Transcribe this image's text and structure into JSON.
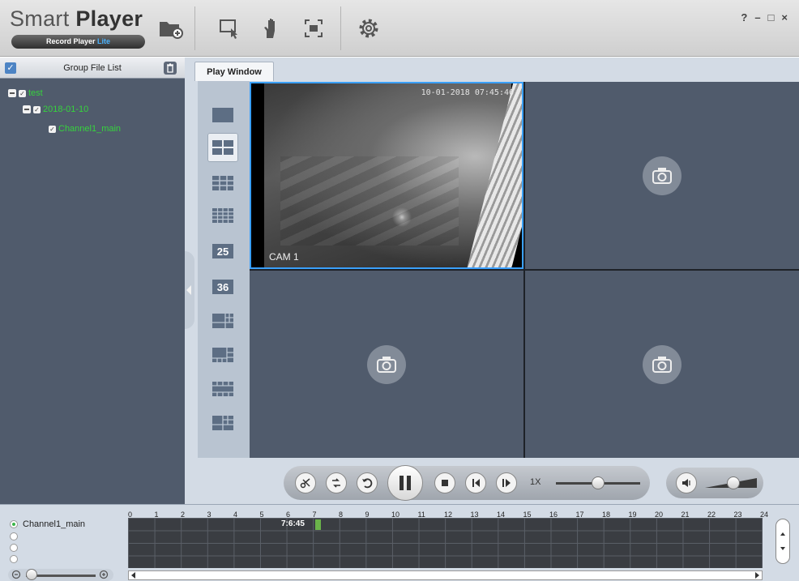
{
  "app": {
    "title_light": "Smart",
    "title_bold": "Player",
    "subtitle": "Record Player",
    "subtitle_accent": "Lite"
  },
  "window_controls": {
    "help": "?",
    "minimize": "–",
    "maximize": "□",
    "close": "×"
  },
  "toolbar": {
    "icons": [
      "open-folder-icon",
      "select-window-icon",
      "hand-pan-icon",
      "fullscreen-icon",
      "settings-gear-icon"
    ]
  },
  "file_panel": {
    "title": "Group File List",
    "tree": [
      {
        "label": "test",
        "level": 0
      },
      {
        "label": "2018-01-10",
        "level": 1
      },
      {
        "label": "Channel1_main",
        "level": 2
      }
    ]
  },
  "tabs": {
    "play_window": "Play Window"
  },
  "layouts": [
    {
      "icon": "layout-1-icon",
      "label": ""
    },
    {
      "icon": "layout-4-icon",
      "label": "",
      "active": true
    },
    {
      "icon": "layout-9-icon",
      "label": ""
    },
    {
      "icon": "layout-16-icon",
      "label": ""
    },
    {
      "icon": "layout-25-icon",
      "label": "25"
    },
    {
      "icon": "layout-36-icon",
      "label": "36"
    },
    {
      "icon": "layout-custom-a-icon",
      "label": ""
    },
    {
      "icon": "layout-custom-b-icon",
      "label": ""
    },
    {
      "icon": "layout-custom-c-icon",
      "label": ""
    },
    {
      "icon": "layout-custom-d-icon",
      "label": ""
    }
  ],
  "video": {
    "timestamp": "10-01-2018 07:45:46",
    "camera_label": "CAM 1"
  },
  "playback": {
    "speed": "1X",
    "speed_level": 0.5,
    "volume_level": 0.55
  },
  "timeline": {
    "channel": "Channel1_main",
    "hours": [
      "0",
      "1",
      "2",
      "3",
      "4",
      "5",
      "6",
      "7",
      "8",
      "9",
      "10",
      "11",
      "12",
      "13",
      "14",
      "15",
      "16",
      "17",
      "18",
      "19",
      "20",
      "21",
      "22",
      "23",
      "24"
    ],
    "current_time": "7:6:45"
  },
  "colors": {
    "accent": "#3aa0ff",
    "tree_text": "#36d33d",
    "panel_bg": "#505b6c",
    "record_mark": "#6ab34a"
  }
}
